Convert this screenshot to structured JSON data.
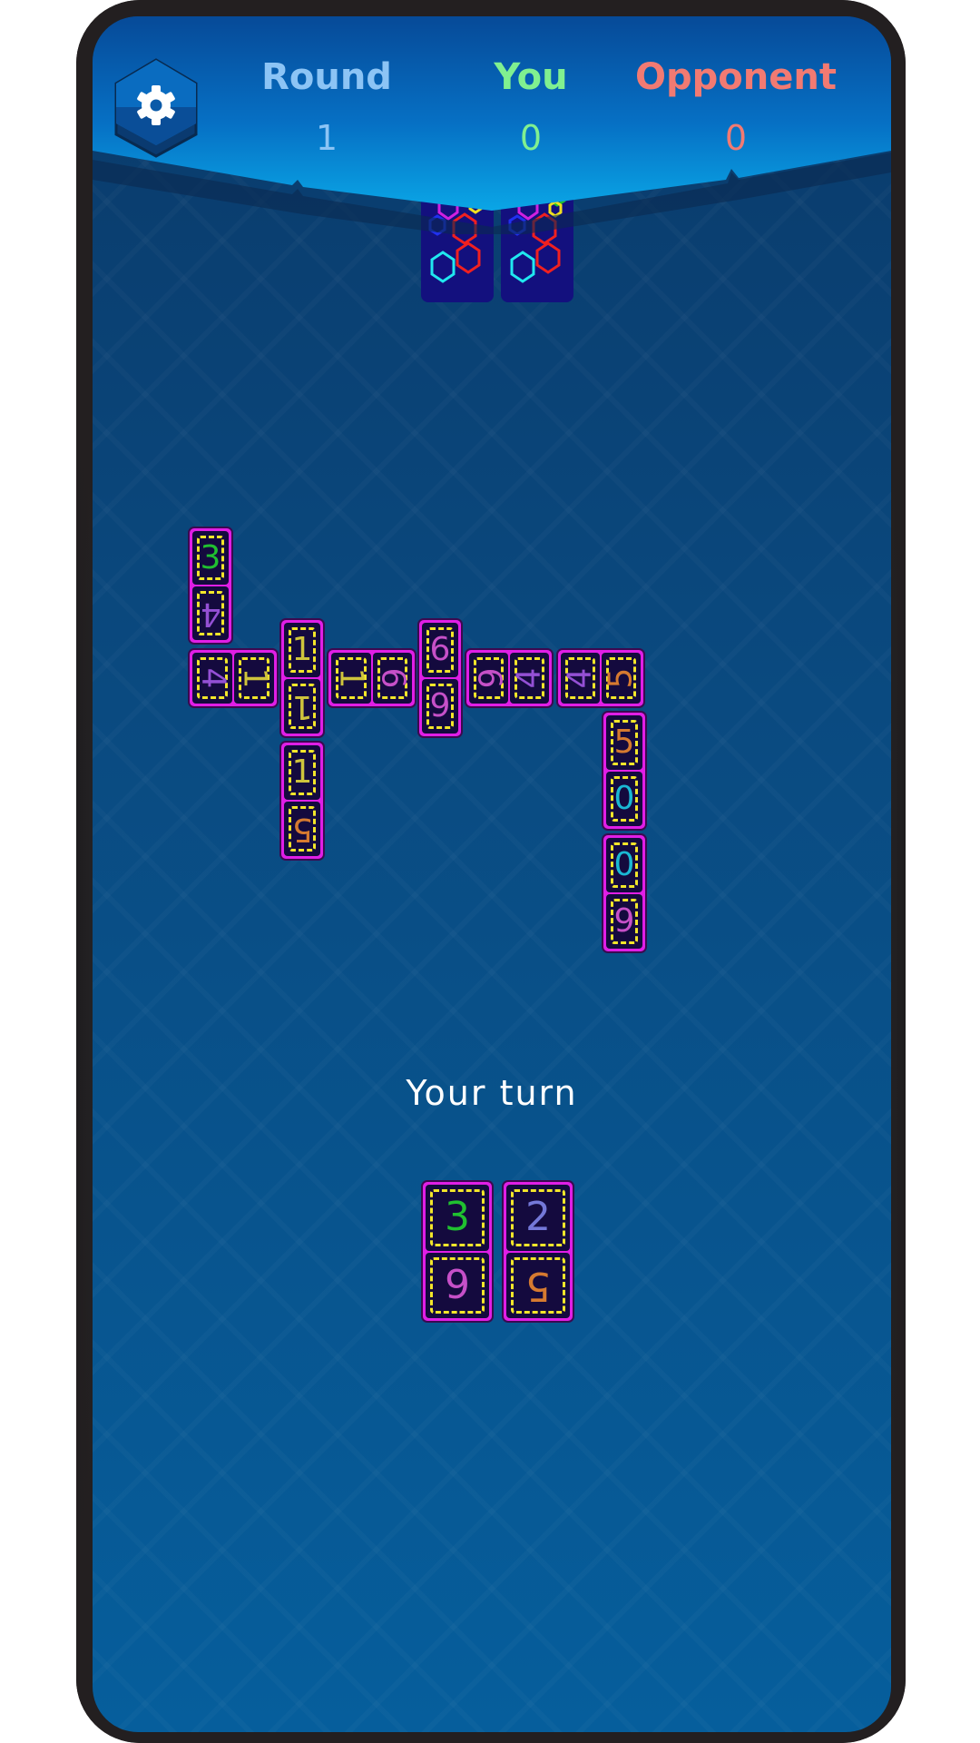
{
  "header": {
    "settings_icon": "gear-icon",
    "round": {
      "label": "Round",
      "value": "1",
      "color": "#8cc4f5"
    },
    "you": {
      "label": "You",
      "value": "0",
      "color": "#80f090"
    },
    "opponent": {
      "label": "Opponent",
      "value": "0",
      "color": "#f27a72"
    }
  },
  "stock": {
    "count": 2,
    "back_art": "neon-hexagons"
  },
  "board": {
    "tiles": [
      {
        "values": [
          3,
          4
        ],
        "orientation": "vertical"
      },
      {
        "values": [
          4,
          1
        ],
        "orientation": "horizontal"
      },
      {
        "values": [
          1,
          1
        ],
        "orientation": "vertical"
      },
      {
        "values": [
          1,
          5
        ],
        "orientation": "vertical"
      },
      {
        "values": [
          1,
          6
        ],
        "orientation": "horizontal"
      },
      {
        "values": [
          6,
          9
        ],
        "orientation": "vertical"
      },
      {
        "values": [
          6,
          4
        ],
        "orientation": "horizontal"
      },
      {
        "values": [
          4,
          5
        ],
        "orientation": "horizontal"
      },
      {
        "values": [
          5,
          0
        ],
        "orientation": "vertical"
      },
      {
        "values": [
          0,
          9
        ],
        "orientation": "vertical"
      }
    ]
  },
  "status": {
    "turn_text": "Your turn"
  },
  "hand": {
    "tiles": [
      {
        "values": [
          3,
          9
        ],
        "orientation": "vertical"
      },
      {
        "values": [
          2,
          5
        ],
        "orientation": "vertical"
      }
    ]
  },
  "digit_colors": {
    "0": "#1ab8d4",
    "1": "#cfc43c",
    "2": "#7478d8",
    "3": "#20c030",
    "4": "#9450d4",
    "5": "#d67a30",
    "6": "#c650c8",
    "9": "#c650c8"
  },
  "colors": {
    "tile_border": "#e01ee6",
    "tile_face": "#140a3e",
    "tile_inner_line": "#f3e62a"
  }
}
